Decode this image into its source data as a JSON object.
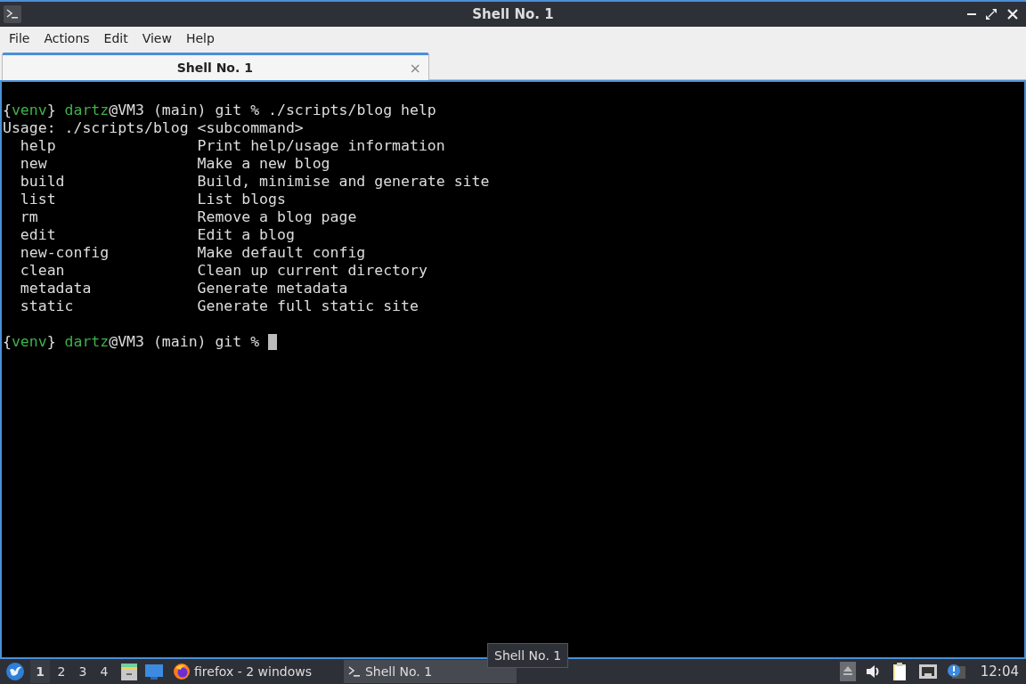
{
  "window": {
    "title": "Shell No. 1"
  },
  "menu": [
    "File",
    "Actions",
    "Edit",
    "View",
    "Help"
  ],
  "tabs": [
    {
      "label": "Shell No. 1",
      "selected": true,
      "close": "×"
    }
  ],
  "terminal": {
    "lines": [
      {
        "segments": [
          {
            "text": "{",
            "kind": "plain"
          },
          {
            "text": "venv",
            "kind": "accent"
          },
          {
            "text": "} ",
            "kind": "plain"
          },
          {
            "text": "dartz",
            "kind": "accent"
          },
          {
            "text": "@VM3 (main) git % ./scripts/blog help",
            "kind": "plain"
          }
        ]
      },
      {
        "segments": [
          {
            "text": "Usage: ./scripts/blog <subcommand>",
            "kind": "plain"
          }
        ]
      },
      {
        "segments": [
          {
            "text": "  help                Print help/usage information",
            "kind": "plain"
          }
        ]
      },
      {
        "segments": [
          {
            "text": "  new                 Make a new blog",
            "kind": "plain"
          }
        ]
      },
      {
        "segments": [
          {
            "text": "  build               Build, minimise and generate site",
            "kind": "plain"
          }
        ]
      },
      {
        "segments": [
          {
            "text": "  list                List blogs",
            "kind": "plain"
          }
        ]
      },
      {
        "segments": [
          {
            "text": "  rm                  Remove a blog page",
            "kind": "plain"
          }
        ]
      },
      {
        "segments": [
          {
            "text": "  edit                Edit a blog",
            "kind": "plain"
          }
        ]
      },
      {
        "segments": [
          {
            "text": "  new-config          Make default config",
            "kind": "plain"
          }
        ]
      },
      {
        "segments": [
          {
            "text": "  clean               Clean up current directory",
            "kind": "plain"
          }
        ]
      },
      {
        "segments": [
          {
            "text": "  metadata            Generate metadata",
            "kind": "plain"
          }
        ]
      },
      {
        "segments": [
          {
            "text": "  static              Generate full static site",
            "kind": "plain"
          }
        ]
      },
      {
        "segments": [
          {
            "text": "{",
            "kind": "plain"
          },
          {
            "text": "venv",
            "kind": "accent"
          },
          {
            "text": "} ",
            "kind": "plain"
          },
          {
            "text": "dartz",
            "kind": "accent"
          },
          {
            "text": "@VM3 (main) git % ",
            "kind": "plain"
          }
        ],
        "cursor": true,
        "blank_before": true
      }
    ]
  },
  "taskbar": {
    "workspaces": [
      {
        "label": "1",
        "selected": true
      },
      {
        "label": "2",
        "selected": false
      },
      {
        "label": "3",
        "selected": false
      },
      {
        "label": "4",
        "selected": false
      }
    ],
    "tasks": [
      {
        "label": "firefox - 2 windows",
        "kind": "browser",
        "selected": false
      },
      {
        "label": "Shell No. 1",
        "kind": "terminal",
        "selected": true
      }
    ],
    "clock": "12:04"
  },
  "tooltip": "Shell No. 1"
}
